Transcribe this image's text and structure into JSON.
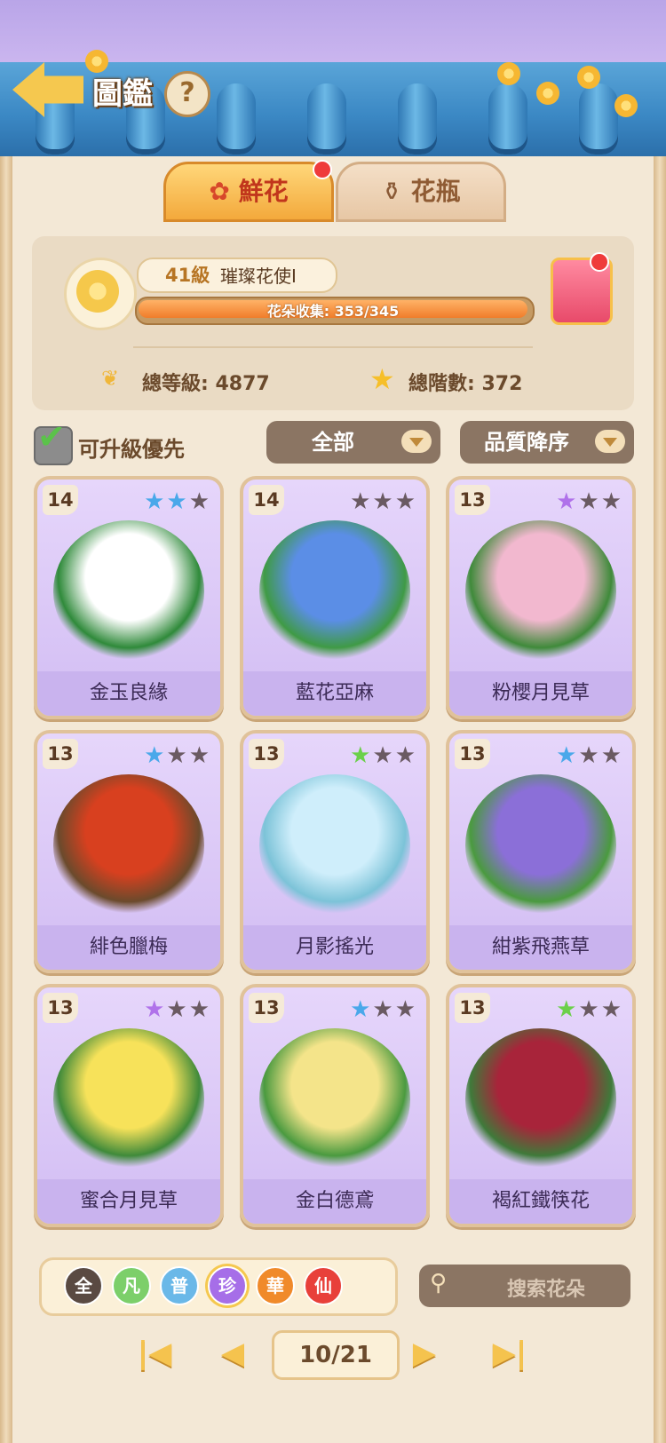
{
  "header": {
    "title": "圖鑑",
    "help_label": "?"
  },
  "tabs": [
    {
      "label": "鮮花",
      "icon": "rose-icon",
      "selected": true,
      "has_dot": true
    },
    {
      "label": "花瓶",
      "icon": "vase-icon",
      "selected": false,
      "has_dot": false
    }
  ],
  "profile": {
    "level_text": "41級",
    "title": "璀璨花使I",
    "progress_label": "花朵收集: 353/345",
    "progress_fraction": 1.0,
    "total_level": "總等級: 4877",
    "total_rank": "總階數: 372",
    "gift_has_dot": true
  },
  "filters": {
    "upgrade_first_label": "可升級優先",
    "upgrade_first_checked": true,
    "category": "全部",
    "sort": "品質降序"
  },
  "cards": [
    {
      "level": "14",
      "name": "金玉良緣",
      "stars": [
        [
          "#4aa8ea",
          1
        ],
        [
          "#4aa8ea",
          1
        ],
        [
          "#6a5a62",
          0
        ]
      ],
      "art": "#ffffff",
      "art2": "#2f8a3a"
    },
    {
      "level": "14",
      "name": "藍花亞麻",
      "stars": [
        [
          "#6a5a62",
          0
        ],
        [
          "#6a5a62",
          0
        ],
        [
          "#6a5a62",
          0
        ]
      ],
      "art": "#5b8ee6",
      "art2": "#3f9a45"
    },
    {
      "level": "13",
      "name": "粉櫻月見草",
      "stars": [
        [
          "#b072ea",
          1
        ],
        [
          "#6a5a62",
          0
        ],
        [
          "#6a5a62",
          0
        ]
      ],
      "art": "#f2b8cf",
      "art2": "#3f8a3a"
    },
    {
      "level": "13",
      "name": "緋色臘梅",
      "stars": [
        [
          "#4aa8ea",
          1
        ],
        [
          "#6a5a62",
          0
        ],
        [
          "#6a5a62",
          0
        ]
      ],
      "art": "#d8401f",
      "art2": "#6b4a2c"
    },
    {
      "level": "13",
      "name": "月影搖光",
      "stars": [
        [
          "#6bd04a",
          1
        ],
        [
          "#6a5a62",
          0
        ],
        [
          "#6a5a62",
          0
        ]
      ],
      "art": "#cfeefb",
      "art2": "#7cc3d8"
    },
    {
      "level": "13",
      "name": "紺紫飛燕草",
      "stars": [
        [
          "#4aa8ea",
          1
        ],
        [
          "#6a5a62",
          0
        ],
        [
          "#6a5a62",
          0
        ]
      ],
      "art": "#8b6fd8",
      "art2": "#4a9a3f"
    },
    {
      "level": "13",
      "name": "蜜合月見草",
      "stars": [
        [
          "#b072ea",
          1
        ],
        [
          "#6a5a62",
          0
        ],
        [
          "#6a5a62",
          0
        ]
      ],
      "art": "#f7e25a",
      "art2": "#3f8a3a"
    },
    {
      "level": "13",
      "name": "金白德鳶",
      "stars": [
        [
          "#4aa8ea",
          1
        ],
        [
          "#6a5a62",
          0
        ],
        [
          "#6a5a62",
          0
        ]
      ],
      "art": "#f4e48a",
      "art2": "#4a9a3f"
    },
    {
      "level": "13",
      "name": "褐紅鐵筷花",
      "stars": [
        [
          "#6bd04a",
          1
        ],
        [
          "#6a5a62",
          0
        ],
        [
          "#6a5a62",
          0
        ]
      ],
      "art": "#a8243a",
      "art2": "#3f7a3a"
    }
  ],
  "rarity": [
    {
      "label": "全",
      "color": "#5a4a42",
      "selected": false
    },
    {
      "label": "凡",
      "color": "#7ccf6a",
      "selected": false
    },
    {
      "label": "普",
      "color": "#6ab8e8",
      "selected": false
    },
    {
      "label": "珍",
      "color": "#a66ee8",
      "selected": true
    },
    {
      "label": "華",
      "color": "#f08a2a",
      "selected": false
    },
    {
      "label": "仙",
      "color": "#e8403a",
      "selected": false
    }
  ],
  "search": {
    "placeholder": "搜索花朵"
  },
  "pager": {
    "page": "10/21"
  }
}
